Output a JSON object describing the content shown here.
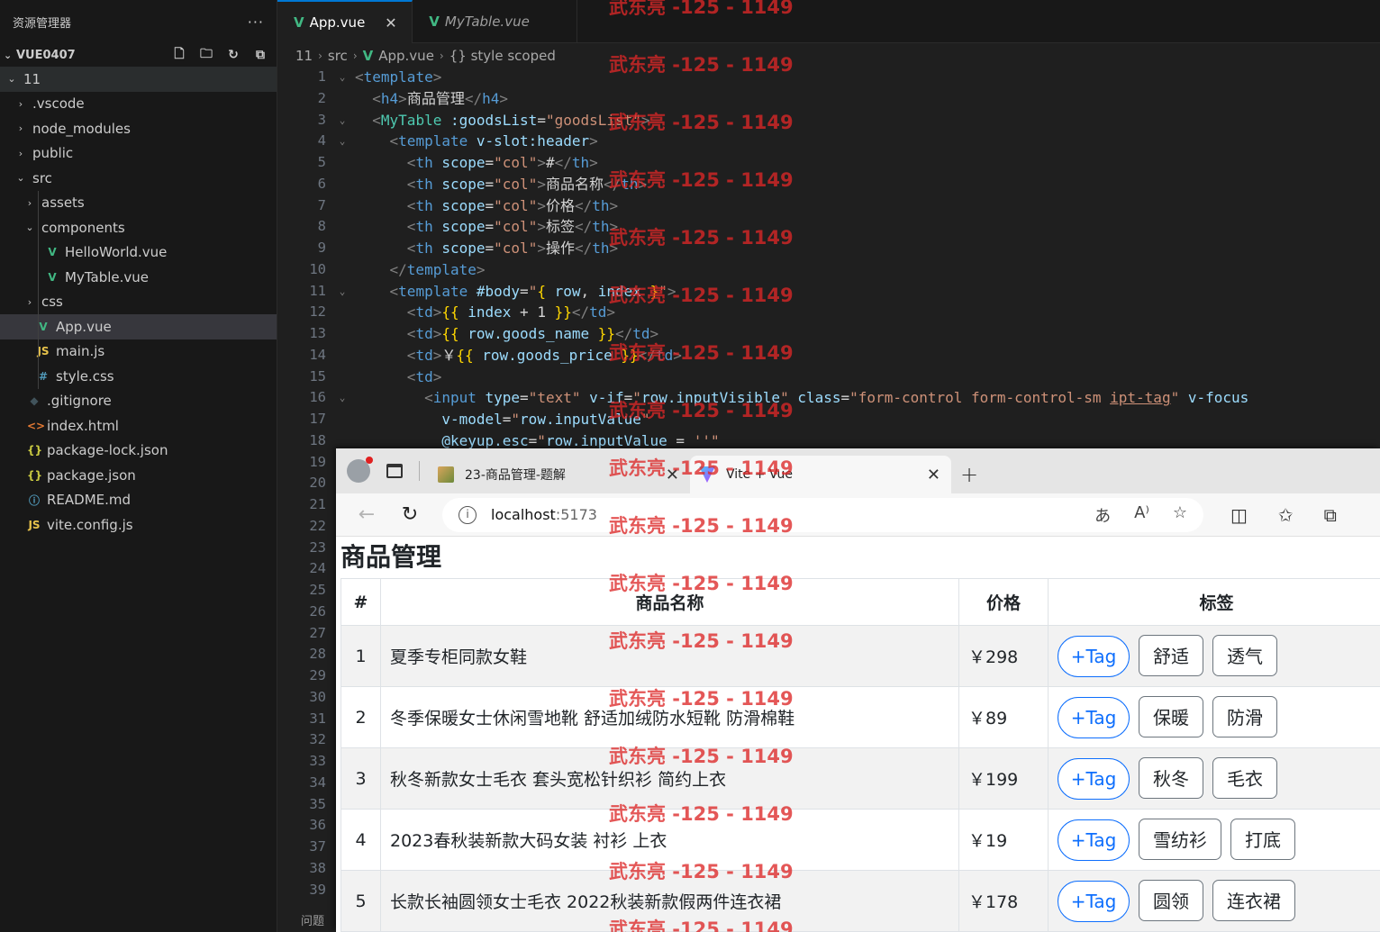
{
  "sidebar": {
    "title": "资源管理器",
    "more": "···",
    "project": "VUE0407",
    "tree": [
      {
        "label": "11",
        "depth": 0,
        "chevron": "⌄",
        "icon": "",
        "iconClass": "",
        "state": "root"
      },
      {
        "label": ".vscode",
        "depth": 1,
        "chevron": "›",
        "icon": "",
        "iconClass": "",
        "state": ""
      },
      {
        "label": "node_modules",
        "depth": 1,
        "chevron": "›",
        "icon": "",
        "iconClass": "",
        "state": ""
      },
      {
        "label": "public",
        "depth": 1,
        "chevron": "›",
        "icon": "",
        "iconClass": "",
        "state": ""
      },
      {
        "label": "src",
        "depth": 1,
        "chevron": "⌄",
        "icon": "",
        "iconClass": "",
        "state": ""
      },
      {
        "label": "assets",
        "depth": 2,
        "chevron": "›",
        "icon": "",
        "iconClass": "",
        "state": ""
      },
      {
        "label": "components",
        "depth": 2,
        "chevron": "⌄",
        "icon": "",
        "iconClass": "",
        "state": ""
      },
      {
        "label": "HelloWorld.vue",
        "depth": 3,
        "chevron": "",
        "icon": "V",
        "iconClass": "ico-vue",
        "state": ""
      },
      {
        "label": "MyTable.vue",
        "depth": 3,
        "chevron": "",
        "icon": "V",
        "iconClass": "ico-vue",
        "state": ""
      },
      {
        "label": "css",
        "depth": 2,
        "chevron": "›",
        "icon": "",
        "iconClass": "",
        "state": ""
      },
      {
        "label": "App.vue",
        "depth": 2,
        "chevron": "",
        "icon": "V",
        "iconClass": "ico-vue",
        "state": "active"
      },
      {
        "label": "main.js",
        "depth": 2,
        "chevron": "",
        "icon": "JS",
        "iconClass": "ico-js",
        "state": ""
      },
      {
        "label": "style.css",
        "depth": 2,
        "chevron": "",
        "icon": "#",
        "iconClass": "ico-css",
        "state": ""
      },
      {
        "label": ".gitignore",
        "depth": 1,
        "chevron": "",
        "icon": "◆",
        "iconClass": "ico-git",
        "state": ""
      },
      {
        "label": "index.html",
        "depth": 1,
        "chevron": "",
        "icon": "<>",
        "iconClass": "ico-html",
        "state": ""
      },
      {
        "label": "package-lock.json",
        "depth": 1,
        "chevron": "",
        "icon": "{}",
        "iconClass": "ico-json",
        "state": ""
      },
      {
        "label": "package.json",
        "depth": 1,
        "chevron": "",
        "icon": "{}",
        "iconClass": "ico-json",
        "state": ""
      },
      {
        "label": "README.md",
        "depth": 1,
        "chevron": "",
        "icon": "ⓘ",
        "iconClass": "ico-info",
        "state": ""
      },
      {
        "label": "vite.config.js",
        "depth": 1,
        "chevron": "",
        "icon": "JS",
        "iconClass": "ico-js",
        "state": ""
      }
    ]
  },
  "editor": {
    "tabs": [
      {
        "label": "App.vue",
        "active": true,
        "close": "✕"
      },
      {
        "label": "MyTable.vue",
        "active": false,
        "close": ""
      }
    ],
    "breadcrumb": [
      "11",
      "src",
      "App.vue",
      "{} style scoped"
    ],
    "problems_label": "问题",
    "line_count": 39,
    "fold_lines": [
      1,
      3,
      4,
      11,
      16
    ],
    "code": [
      [
        [
          "b",
          "<"
        ],
        [
          "t",
          "template"
        ],
        [
          "b",
          ">"
        ]
      ],
      [
        [
          "x",
          "  "
        ],
        [
          "b",
          "<"
        ],
        [
          "t",
          "h4"
        ],
        [
          "b",
          ">"
        ],
        [
          "x",
          "商品管理"
        ],
        [
          "b",
          "</"
        ],
        [
          "t",
          "h4"
        ],
        [
          "b",
          ">"
        ]
      ],
      [
        [
          "x",
          "  "
        ],
        [
          "b",
          "<"
        ],
        [
          "tt",
          "MyTable"
        ],
        [
          "x",
          " "
        ],
        [
          "a",
          ":goodsList"
        ],
        [
          "x",
          "="
        ],
        [
          "s",
          "\"goodsList\""
        ],
        [
          "b",
          ">"
        ]
      ],
      [
        [
          "x",
          "    "
        ],
        [
          "b",
          "<"
        ],
        [
          "t",
          "template"
        ],
        [
          "x",
          " "
        ],
        [
          "a",
          "v-slot:header"
        ],
        [
          "b",
          ">"
        ]
      ],
      [
        [
          "x",
          "      "
        ],
        [
          "b",
          "<"
        ],
        [
          "t",
          "th"
        ],
        [
          "x",
          " "
        ],
        [
          "a",
          "scope"
        ],
        [
          "x",
          "="
        ],
        [
          "s",
          "\"col\""
        ],
        [
          "b",
          ">"
        ],
        [
          "x",
          "#"
        ],
        [
          "b",
          "</"
        ],
        [
          "t",
          "th"
        ],
        [
          "b",
          ">"
        ]
      ],
      [
        [
          "x",
          "      "
        ],
        [
          "b",
          "<"
        ],
        [
          "t",
          "th"
        ],
        [
          "x",
          " "
        ],
        [
          "a",
          "scope"
        ],
        [
          "x",
          "="
        ],
        [
          "s",
          "\"col\""
        ],
        [
          "b",
          ">"
        ],
        [
          "x",
          "商品名称"
        ],
        [
          "b",
          "</"
        ],
        [
          "t",
          "th"
        ],
        [
          "b",
          ">"
        ]
      ],
      [
        [
          "x",
          "      "
        ],
        [
          "b",
          "<"
        ],
        [
          "t",
          "th"
        ],
        [
          "x",
          " "
        ],
        [
          "a",
          "scope"
        ],
        [
          "x",
          "="
        ],
        [
          "s",
          "\"col\""
        ],
        [
          "b",
          ">"
        ],
        [
          "x",
          "价格"
        ],
        [
          "b",
          "</"
        ],
        [
          "t",
          "th"
        ],
        [
          "b",
          ">"
        ]
      ],
      [
        [
          "x",
          "      "
        ],
        [
          "b",
          "<"
        ],
        [
          "t",
          "th"
        ],
        [
          "x",
          " "
        ],
        [
          "a",
          "scope"
        ],
        [
          "x",
          "="
        ],
        [
          "s",
          "\"col\""
        ],
        [
          "b",
          ">"
        ],
        [
          "x",
          "标签"
        ],
        [
          "b",
          "</"
        ],
        [
          "t",
          "th"
        ],
        [
          "b",
          ">"
        ]
      ],
      [
        [
          "x",
          "      "
        ],
        [
          "b",
          "<"
        ],
        [
          "t",
          "th"
        ],
        [
          "x",
          " "
        ],
        [
          "a",
          "scope"
        ],
        [
          "x",
          "="
        ],
        [
          "s",
          "\"col\""
        ],
        [
          "b",
          ">"
        ],
        [
          "x",
          "操作"
        ],
        [
          "b",
          "</"
        ],
        [
          "t",
          "th"
        ],
        [
          "b",
          ">"
        ]
      ],
      [
        [
          "x",
          "    "
        ],
        [
          "b",
          "</"
        ],
        [
          "t",
          "template"
        ],
        [
          "b",
          ">"
        ]
      ],
      [
        [
          "x",
          "    "
        ],
        [
          "b",
          "<"
        ],
        [
          "t",
          "template"
        ],
        [
          "x",
          " "
        ],
        [
          "a",
          "#body"
        ],
        [
          "x",
          "="
        ],
        [
          "s",
          "\""
        ],
        [
          "y",
          "{ "
        ],
        [
          "v",
          "row"
        ],
        [
          "x",
          ", "
        ],
        [
          "v",
          "index"
        ],
        [
          "y",
          " }"
        ],
        [
          "s",
          "\""
        ],
        [
          "b",
          ">"
        ]
      ],
      [
        [
          "x",
          "      "
        ],
        [
          "b",
          "<"
        ],
        [
          "t",
          "td"
        ],
        [
          "b",
          ">"
        ],
        [
          "y",
          "{{ "
        ],
        [
          "v",
          "index"
        ],
        [
          "x",
          " + 1 "
        ],
        [
          "y",
          "}}"
        ],
        [
          "b",
          "</"
        ],
        [
          "t",
          "td"
        ],
        [
          "b",
          ">"
        ]
      ],
      [
        [
          "x",
          "      "
        ],
        [
          "b",
          "<"
        ],
        [
          "t",
          "td"
        ],
        [
          "b",
          ">"
        ],
        [
          "y",
          "{{ "
        ],
        [
          "v",
          "row.goods_name"
        ],
        [
          "y",
          " }}"
        ],
        [
          "b",
          "</"
        ],
        [
          "t",
          "td"
        ],
        [
          "b",
          ">"
        ]
      ],
      [
        [
          "x",
          "      "
        ],
        [
          "b",
          "<"
        ],
        [
          "t",
          "td"
        ],
        [
          "b",
          ">"
        ],
        [
          "x",
          "￥"
        ],
        [
          "y",
          "{{ "
        ],
        [
          "v",
          "row.goods_price"
        ],
        [
          "y",
          " }}"
        ],
        [
          "b",
          "</"
        ],
        [
          "t",
          "td"
        ],
        [
          "b",
          ">"
        ]
      ],
      [
        [
          "x",
          "      "
        ],
        [
          "b",
          "<"
        ],
        [
          "t",
          "td"
        ],
        [
          "b",
          ">"
        ]
      ],
      [
        [
          "x",
          "        "
        ],
        [
          "b",
          "<"
        ],
        [
          "t",
          "input"
        ],
        [
          "x",
          " "
        ],
        [
          "a",
          "type"
        ],
        [
          "x",
          "="
        ],
        [
          "s",
          "\"text\""
        ],
        [
          "x",
          " "
        ],
        [
          "a",
          "v-if"
        ],
        [
          "x",
          "="
        ],
        [
          "s",
          "\""
        ],
        [
          "v",
          "row.inputVisible"
        ],
        [
          "s",
          "\""
        ],
        [
          "x",
          " "
        ],
        [
          "a",
          "class"
        ],
        [
          "x",
          "="
        ],
        [
          "s",
          "\"form-control form-control-sm "
        ],
        [
          "u",
          "ipt-tag"
        ],
        [
          "s",
          "\""
        ],
        [
          "x",
          " "
        ],
        [
          "a",
          "v-focus"
        ]
      ],
      [
        [
          "x",
          "          "
        ],
        [
          "a",
          "v-model"
        ],
        [
          "x",
          "="
        ],
        [
          "s",
          "\""
        ],
        [
          "v",
          "row.inputValue"
        ],
        [
          "s",
          "\""
        ]
      ],
      [
        [
          "x",
          "          "
        ],
        [
          "a",
          "@keyup.esc"
        ],
        [
          "x",
          "="
        ],
        [
          "s",
          "\""
        ],
        [
          "v",
          "row.inputValue"
        ],
        [
          "x",
          " = "
        ],
        [
          "s",
          "''"
        ],
        [
          "s",
          "\""
        ]
      ]
    ]
  },
  "browser": {
    "tabs": [
      {
        "label": "23-商品管理-题解",
        "favicon": "fav-img",
        "active": false
      },
      {
        "label": "Vite + Vue",
        "favicon": "fav-vite",
        "active": true
      }
    ],
    "new_tab": "+",
    "close_glyph": "✕",
    "url_host": "localhost",
    "url_port": ":5173",
    "page": {
      "title": "商品管理",
      "headers": [
        "#",
        "商品名称",
        "价格",
        "标签"
      ],
      "add_tag_label": "+Tag",
      "rows": [
        {
          "index": "1",
          "name": "夏季专柜同款女鞋",
          "price": "￥298",
          "tags": [
            "舒适",
            "透气"
          ]
        },
        {
          "index": "2",
          "name": "冬季保暖女士休闲雪地靴 舒适加绒防水短靴 防滑棉鞋",
          "price": "￥89",
          "tags": [
            "保暖",
            "防滑"
          ]
        },
        {
          "index": "3",
          "name": "秋冬新款女士毛衣 套头宽松针织衫 简约上衣",
          "price": "￥199",
          "tags": [
            "秋冬",
            "毛衣"
          ]
        },
        {
          "index": "4",
          "name": "2023春秋装新款大码女装 衬衫 上衣",
          "price": "￥19",
          "tags": [
            "雪纺衫",
            "打底"
          ]
        },
        {
          "index": "5",
          "name": "长款长袖圆领女士毛衣 2022秋装新款假两件连衣裙",
          "price": "￥178",
          "tags": [
            "圆领",
            "连衣裙"
          ]
        }
      ]
    }
  },
  "watermark": "武东亮 -125 - 1149",
  "watermark_count": 17
}
